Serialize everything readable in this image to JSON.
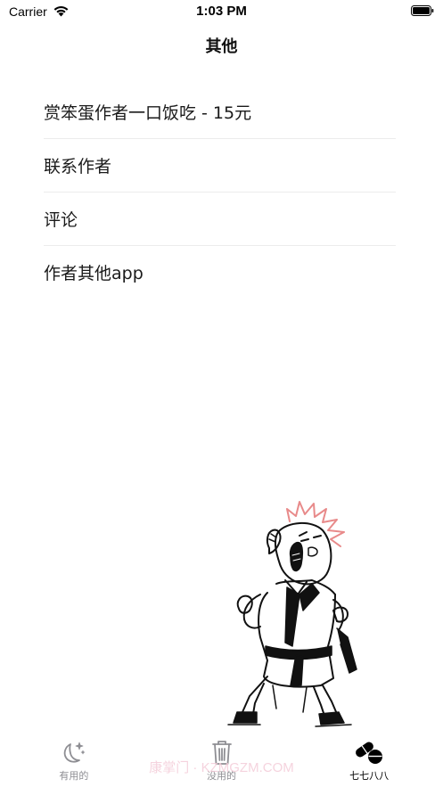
{
  "status_bar": {
    "carrier": "Carrier",
    "time": "1:03 PM",
    "wifi_icon": "wifi-icon",
    "battery_icon": "battery-icon"
  },
  "nav": {
    "title": "其他"
  },
  "menu": {
    "items": [
      {
        "label": "赏笨蛋作者一口饭吃 - 15元"
      },
      {
        "label": "联系作者"
      },
      {
        "label": "评论"
      },
      {
        "label": "作者其他app"
      }
    ]
  },
  "illustration": {
    "icon": "cartoon-character-illustration"
  },
  "tab_bar": {
    "tabs": [
      {
        "label": "有用的",
        "icon": "moon-stars-icon",
        "active": false
      },
      {
        "label": "没用的",
        "icon": "trash-icon",
        "active": false
      },
      {
        "label": "七七八八",
        "icon": "pills-icon",
        "active": true
      }
    ],
    "active_color": "#000000",
    "inactive_color": "#8e8e93"
  },
  "watermark": {
    "text": "康掌门 · KZMGZM.COM"
  }
}
